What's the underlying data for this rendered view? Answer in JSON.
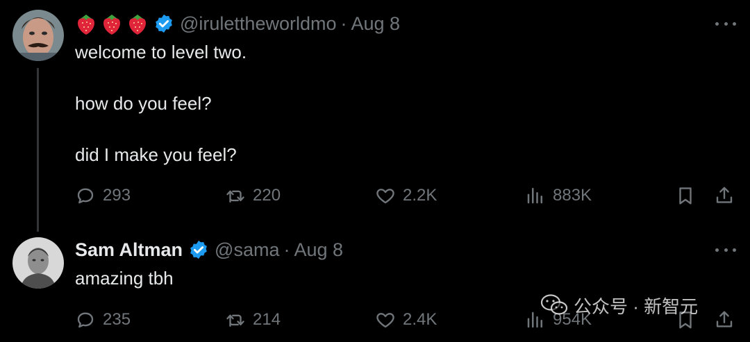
{
  "tweets": [
    {
      "author_name": "",
      "name_emoji": [
        "strawberry-icon",
        "strawberry-icon",
        "strawberry-icon"
      ],
      "verified": true,
      "handle": "@irulettheworldmo",
      "separator": "·",
      "date": "Aug 8",
      "text": "welcome to level two.\n\nhow do you feel?\n\ndid I make you feel?",
      "stats": {
        "replies": "293",
        "retweets": "220",
        "likes": "2.2K",
        "views": "883K"
      }
    },
    {
      "author_name": "Sam Altman",
      "verified": true,
      "handle": "@sama",
      "separator": "·",
      "date": "Aug 8",
      "text": "amazing tbh",
      "stats": {
        "replies": "235",
        "retweets": "214",
        "likes": "2.4K",
        "views": "954K"
      }
    }
  ],
  "watermark": {
    "text": "公众号 · 新智元",
    "icon": "wechat-icon"
  },
  "colors": {
    "background": "#000000",
    "text": "#e7e9ea",
    "muted": "#71767b",
    "verified": "#1d9bf0",
    "thread_line": "#333639"
  }
}
